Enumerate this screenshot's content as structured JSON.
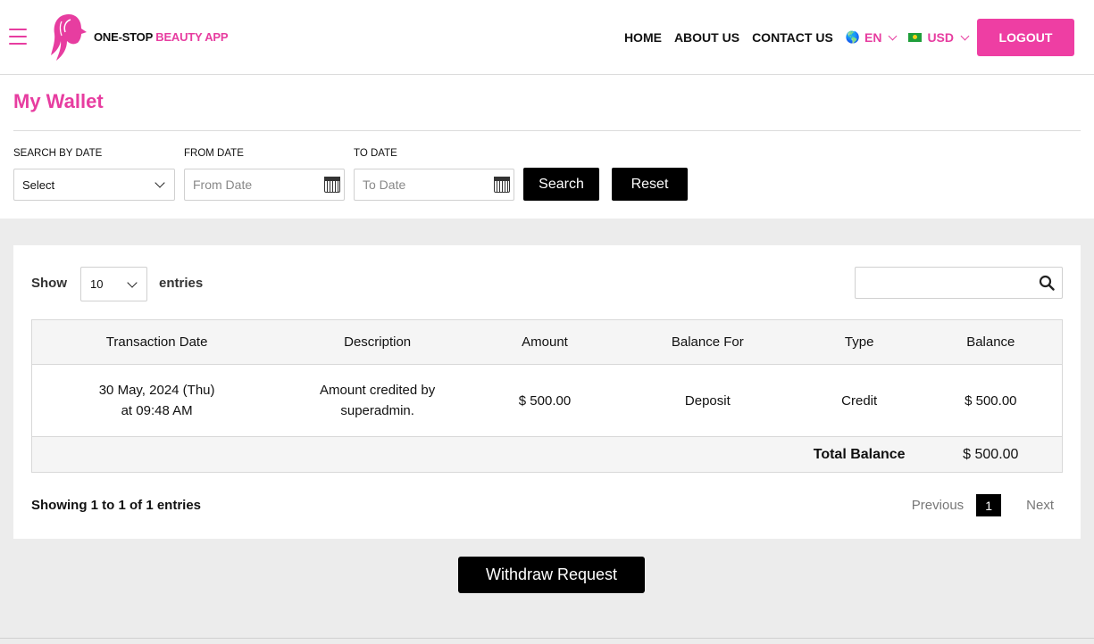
{
  "header": {
    "brand_dark": "ONE-STOP",
    "brand_pink": "BEAUTY APP",
    "nav": [
      "HOME",
      "ABOUT US",
      "CONTACT US"
    ],
    "language": "EN",
    "currency": "USD",
    "logout_label": "LOGOUT"
  },
  "page": {
    "title": "My Wallet"
  },
  "filters": {
    "search_by_date_label": "SEARCH BY DATE",
    "search_by_date_value": "Select",
    "from_date_label": "FROM DATE",
    "from_date_placeholder": "From Date",
    "to_date_label": "TO DATE",
    "to_date_placeholder": "To Date",
    "search_label": "Search",
    "reset_label": "Reset"
  },
  "table": {
    "show_label": "Show",
    "page_length": "10",
    "entries_label": "entries",
    "columns": [
      "Transaction Date",
      "Description",
      "Amount",
      "Balance For",
      "Type",
      "Balance"
    ],
    "rows": [
      {
        "date_line1": "30 May, 2024 (Thu)",
        "date_line2": "at 09:48 AM",
        "description_line1": "Amount credited by",
        "description_line2": "superadmin.",
        "amount": "$ 500.00",
        "balance_for": "Deposit",
        "type": "Credit",
        "balance": "$ 500.00"
      }
    ],
    "total_label": "Total Balance",
    "total_value": "$ 500.00",
    "info": "Showing 1 to 1 of 1 entries",
    "pager": {
      "previous": "Previous",
      "current": "1",
      "next": "Next"
    }
  },
  "actions": {
    "withdraw_label": "Withdraw Request"
  },
  "colors": {
    "brand_pink": "#e73da0",
    "logout_bg": "#ee3ea3",
    "button_black": "#000000"
  },
  "icons": [
    "hamburger-menu-icon",
    "brand-logo-icon",
    "globe-icon",
    "flag-icon",
    "chevron-down-icon",
    "calendar-icon",
    "search-icon"
  ]
}
